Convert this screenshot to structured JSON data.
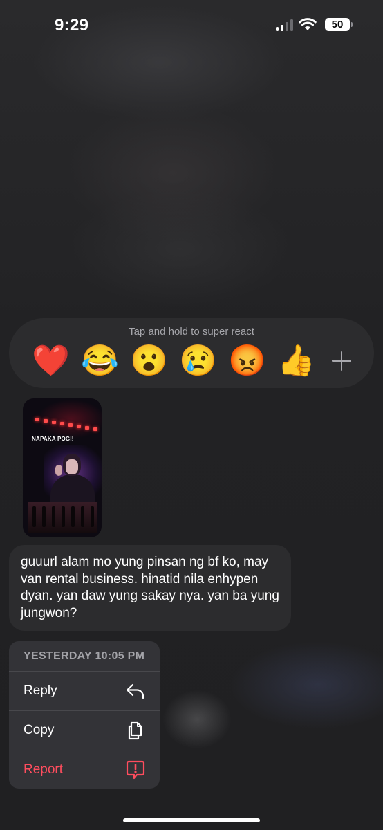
{
  "status_bar": {
    "time": "9:29",
    "battery": "50",
    "icons": [
      "cellular-signal-icon",
      "wifi-icon",
      "battery-icon"
    ]
  },
  "reactions": {
    "hint": "Tap and hold to super react",
    "emojis": [
      {
        "name": "red-heart",
        "glyph": "❤️"
      },
      {
        "name": "face-with-tears-of-joy",
        "glyph": "😂"
      },
      {
        "name": "face-with-open-mouth",
        "glyph": "😮"
      },
      {
        "name": "crying-face",
        "glyph": "😢"
      },
      {
        "name": "angry-face",
        "glyph": "😡"
      },
      {
        "name": "thumbs-up",
        "glyph": "👍"
      }
    ],
    "more_icon": "plus-icon"
  },
  "message": {
    "image_caption": "NAPAKA POGI!",
    "text": "guuurl alam mo yung pinsan ng bf ko, may van rental business. hinatid nila enhypen dyan. yan daw yung sakay nya. yan ba yung jungwon?"
  },
  "context_menu": {
    "timestamp": "YESTERDAY 10:05 PM",
    "items": [
      {
        "label": "Reply",
        "icon": "reply-arrow-icon",
        "color": "#ffffff"
      },
      {
        "label": "Copy",
        "icon": "copy-icon",
        "color": "#ffffff"
      },
      {
        "label": "Report",
        "icon": "report-icon",
        "color": "#ff4d5e"
      }
    ]
  },
  "colors": {
    "surface": "#2c2c2e",
    "menu_bg": "#343438",
    "danger": "#ff4d5e",
    "muted_text": "#a6a6ab"
  }
}
